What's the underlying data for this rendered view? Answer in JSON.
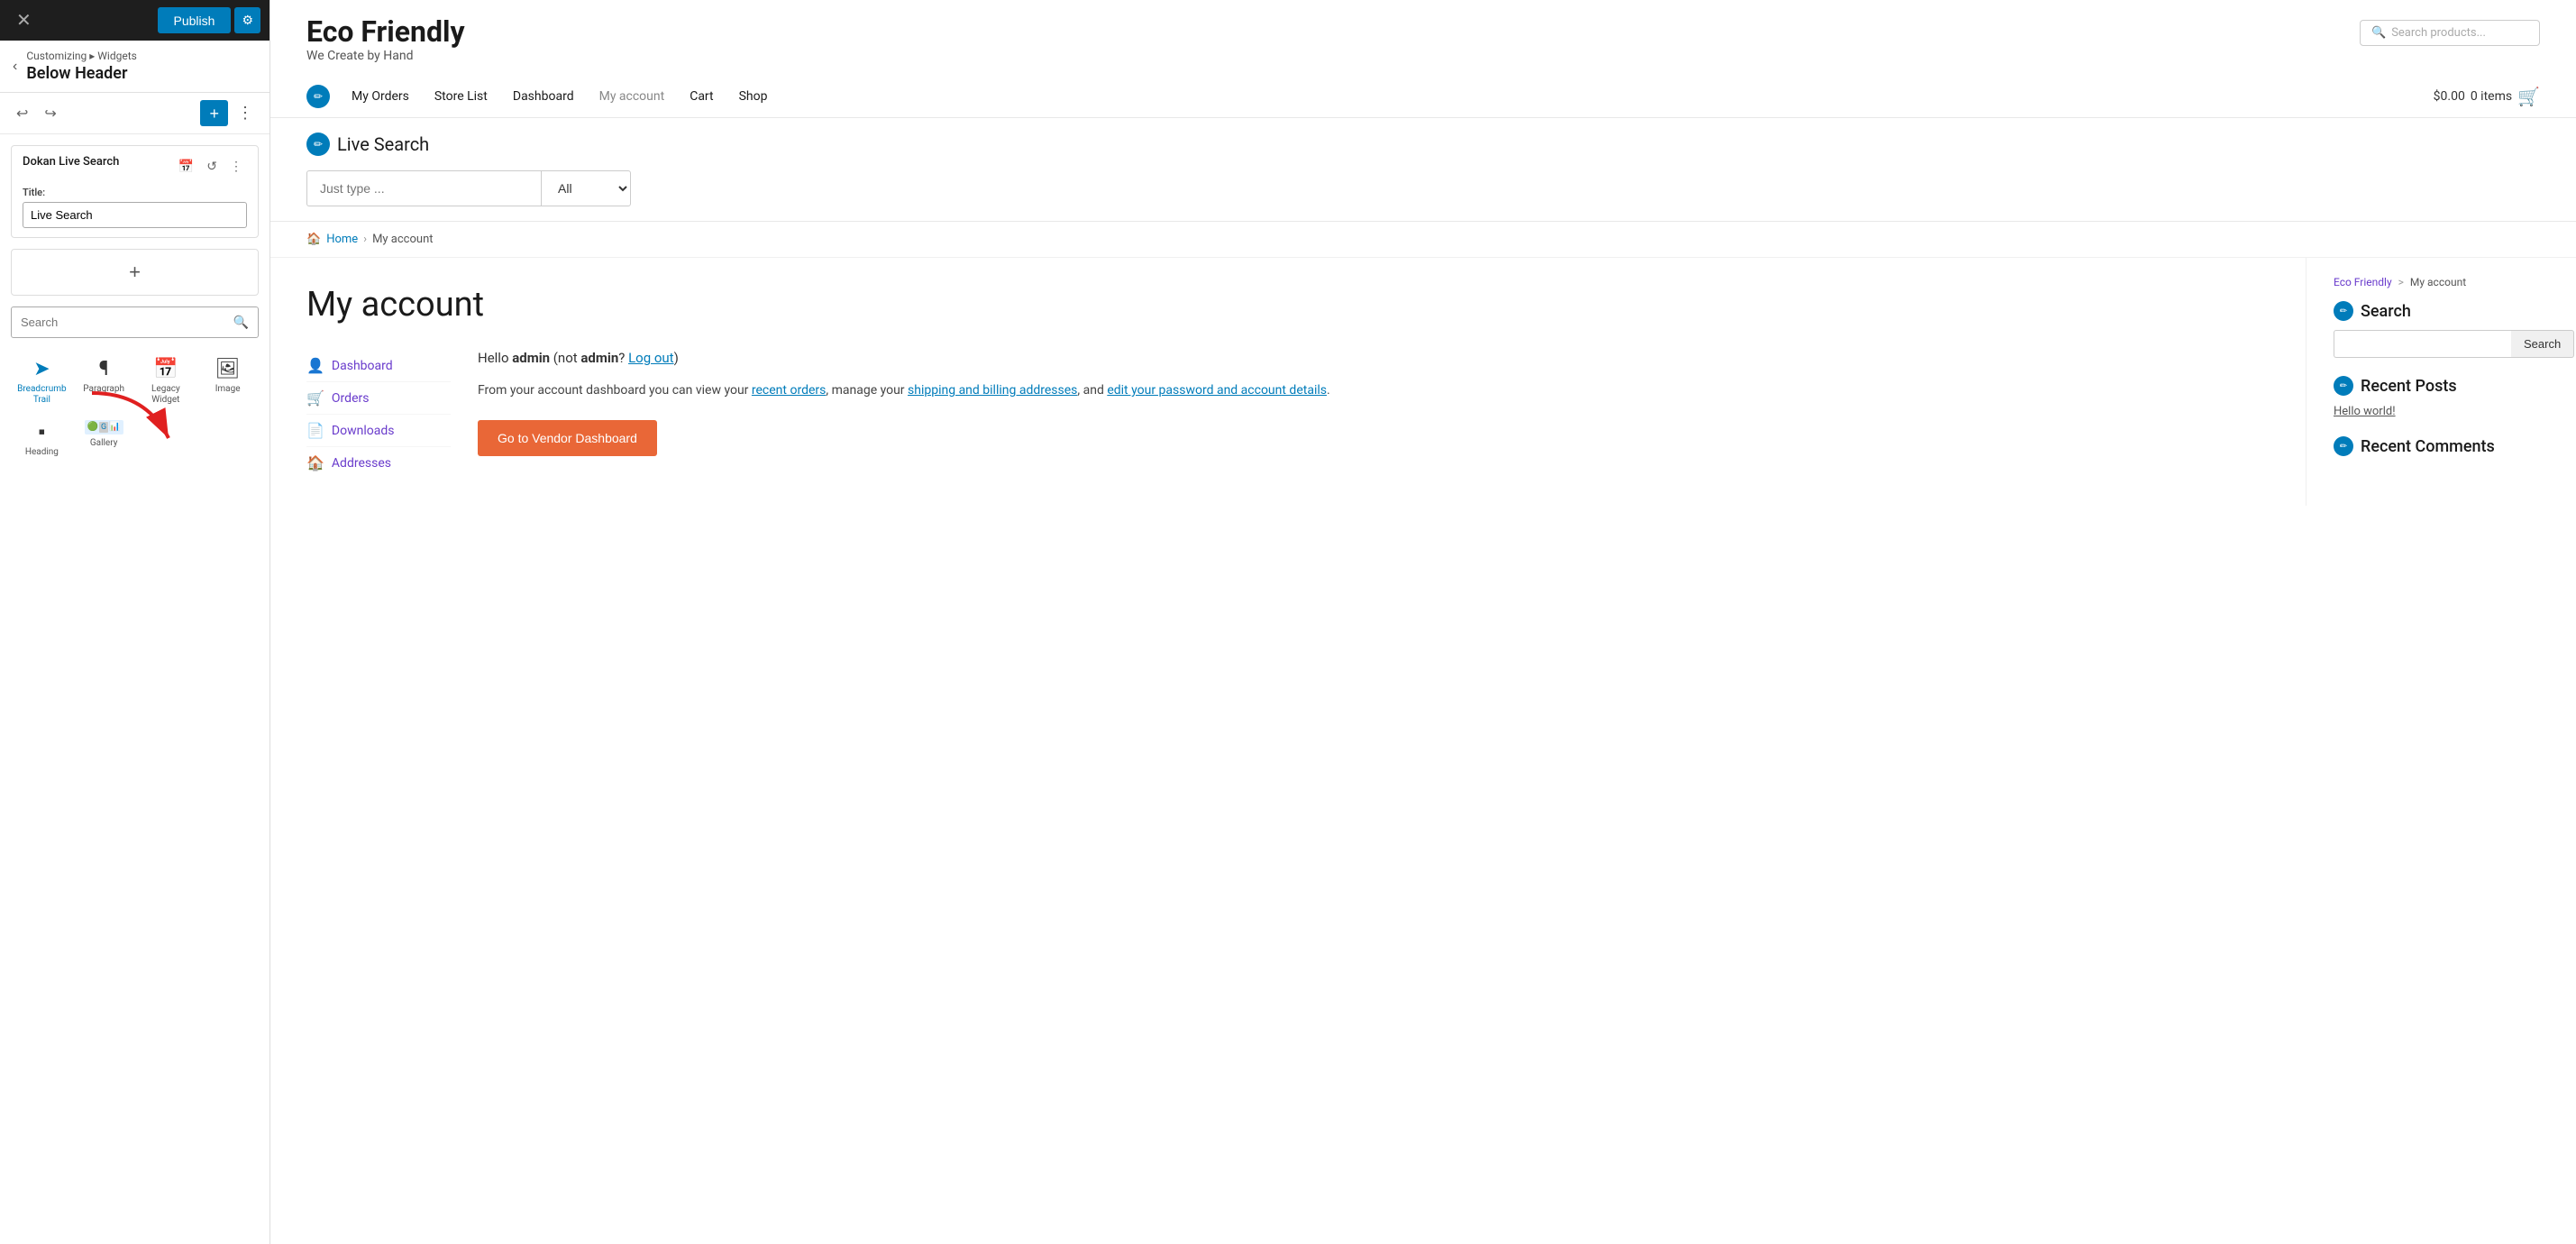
{
  "top_bar": {
    "close_label": "✕",
    "publish_label": "Publish",
    "gear_label": "⚙"
  },
  "back_bar": {
    "breadcrumb": "Customizing ▸ Widgets",
    "title": "Below Header",
    "back_icon": "‹"
  },
  "undo_redo": {
    "undo_icon": "↩",
    "redo_icon": "↪",
    "add_label": "+",
    "more_label": "⋮"
  },
  "widget_card": {
    "title": "Dokan Live Search",
    "title_field_label": "Title:",
    "title_field_value": "Live Search",
    "icons": [
      "📅",
      "↺",
      "⋮"
    ]
  },
  "add_block": {
    "label": "+"
  },
  "left_search": {
    "placeholder": "Search",
    "icon": "🔍"
  },
  "block_grid": [
    {
      "icon": "➤",
      "label": "Breadcrumb Trail",
      "active": true
    },
    {
      "icon": "¶",
      "label": "Paragraph"
    },
    {
      "icon": "📅",
      "label": "Legacy Widget"
    },
    {
      "icon": "🖼",
      "label": "Image"
    },
    {
      "icon": "▪",
      "label": "Heading"
    },
    {
      "icon": "🖼",
      "label": "Gallery"
    }
  ],
  "site": {
    "title": "Eco Friendly",
    "tagline": "We Create by Hand",
    "search_placeholder": "Search products..."
  },
  "nav": {
    "items": [
      {
        "label": "My Orders"
      },
      {
        "label": "Store List"
      },
      {
        "label": "Dashboard"
      },
      {
        "label": "My account",
        "dimmed": true
      },
      {
        "label": "Cart"
      },
      {
        "label": "Shop"
      }
    ],
    "cart": {
      "amount": "$0.00",
      "items": "0 items"
    }
  },
  "live_search": {
    "section_title": "Live Search",
    "input_placeholder": "Just type ...",
    "select_options": [
      "All"
    ],
    "select_default": "All"
  },
  "breadcrumb": {
    "icon": "🏠",
    "home_label": "Home",
    "separator": "›",
    "current": "My account"
  },
  "my_account": {
    "page_title": "My account",
    "nav_items": [
      {
        "label": "Dashboard",
        "icon": "👤"
      },
      {
        "label": "Orders",
        "icon": "🛒"
      },
      {
        "label": "Downloads",
        "icon": "📄"
      },
      {
        "label": "Addresses",
        "icon": "🏠"
      }
    ],
    "hello_text": "Hello",
    "hello_user": "admin",
    "not_text": "(not",
    "not_user": "admin",
    "logout_label": "Log out",
    "desc1": "From your account dashboard you can view your",
    "link1": "recent orders",
    "desc2": ", manage your",
    "link2": "shipping and billing addresses",
    "desc3": ", and",
    "link3": "edit your password and account details",
    "desc4": ".",
    "vendor_btn_label": "Go to Vendor Dashboard"
  },
  "sidebar": {
    "breadcrumb_site": "Eco Friendly",
    "breadcrumb_sep": ">",
    "breadcrumb_page": "My account",
    "search_section": {
      "title": "Search",
      "input_placeholder": "",
      "btn_label": "Search"
    },
    "recent_posts": {
      "title": "Recent Posts",
      "items": [
        {
          "label": "Hello world!"
        }
      ]
    },
    "recent_comments": {
      "title": "Recent Comments"
    }
  }
}
